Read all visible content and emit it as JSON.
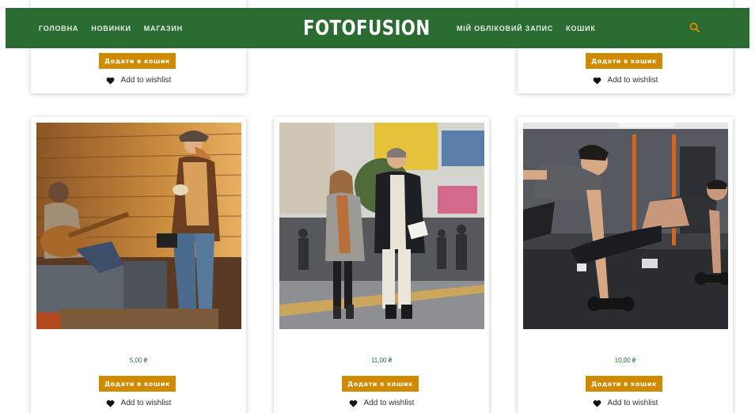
{
  "header": {
    "nav_left": [
      "ГОЛОВНА",
      "НОВИНКИ",
      "МАГАЗИН"
    ],
    "logo": "FOTOFUSION",
    "nav_right": [
      "МІЙ ОБЛІКОВИЙ ЗАПИС",
      "КОШИК"
    ],
    "search_icon": "search-icon",
    "accent": "#2a6b32",
    "search_color": "#d08a00"
  },
  "top_row": [
    {
      "button": "Додати в кошик",
      "wishlist": "Add to wishlist"
    },
    {
      "button": "Додати в кошик",
      "wishlist": "Add to wishlist"
    }
  ],
  "products": [
    {
      "image": "couple-with-guitar-photo",
      "price": "5,00 ₴",
      "button": "Додати в кошик",
      "wishlist": "Add to wishlist"
    },
    {
      "image": "couple-walking-street-photo",
      "price": "11,00 ₴",
      "button": "Додати в кошик",
      "wishlist": "Add to wishlist"
    },
    {
      "image": "gym-workout-photo",
      "price": "10,00 ₴",
      "button": "Додати в кошик",
      "wishlist": "Add to wishlist"
    }
  ],
  "colors": {
    "button": "#d08a00",
    "price": "#2a6b32"
  }
}
